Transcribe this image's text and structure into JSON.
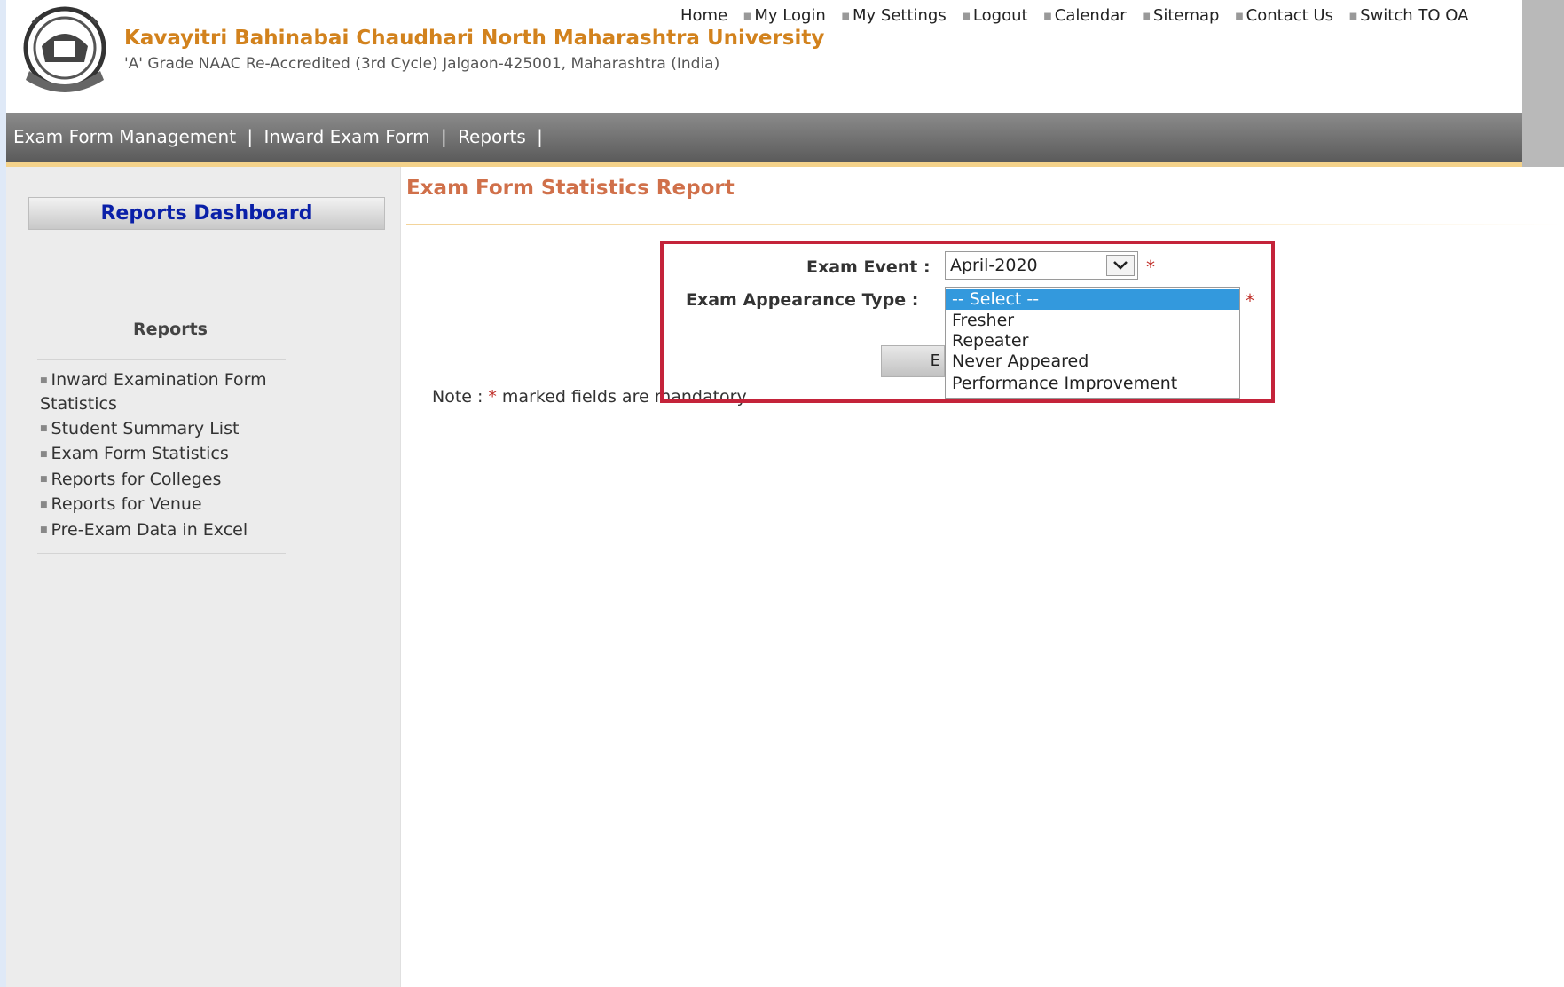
{
  "header": {
    "title": "Kavayitri Bahinabai Chaudhari North Maharashtra University",
    "subtitle": "'A' Grade NAAC Re-Accredited (3rd Cycle) Jalgaon-425001, Maharashtra (India)",
    "toplinks": [
      "Home",
      "My Login",
      "My Settings",
      "Logout",
      "Calendar",
      "Sitemap",
      "Contact Us",
      "Switch TO OA"
    ]
  },
  "nav": {
    "items": [
      "Exam Form Management",
      "Inward Exam Form",
      "Reports"
    ],
    "separator": "|"
  },
  "sidebar": {
    "dashboard_title": "Reports Dashboard",
    "section_title": "Reports",
    "items": [
      "Inward Examination Form Statistics",
      "Student Summary List",
      "Exam Form Statistics",
      "Reports for Colleges",
      "Reports for Venue",
      "Pre-Exam Data in Excel"
    ]
  },
  "main": {
    "title": "Exam Form Statistics Report",
    "form": {
      "exam_event_label": "Exam Event :",
      "exam_event_value": "April-2020",
      "appearance_label": "Exam Appearance Type :",
      "appearance_options": [
        "-- Select --",
        "Fresher",
        "Repeater",
        "Never Appeared",
        "Performance Improvement"
      ],
      "appearance_selected": "-- Select --",
      "required_mark": "*",
      "button_fragment": "E"
    },
    "note": {
      "prefix": "Note :",
      "star": "*",
      "text": "marked fields are mandatory"
    }
  },
  "colors": {
    "university_name": "#d2821d",
    "dashboard_title": "#0a20a8",
    "page_title": "#d0704a",
    "highlight_border": "#c4233a",
    "selected_option": "#3399dd"
  }
}
